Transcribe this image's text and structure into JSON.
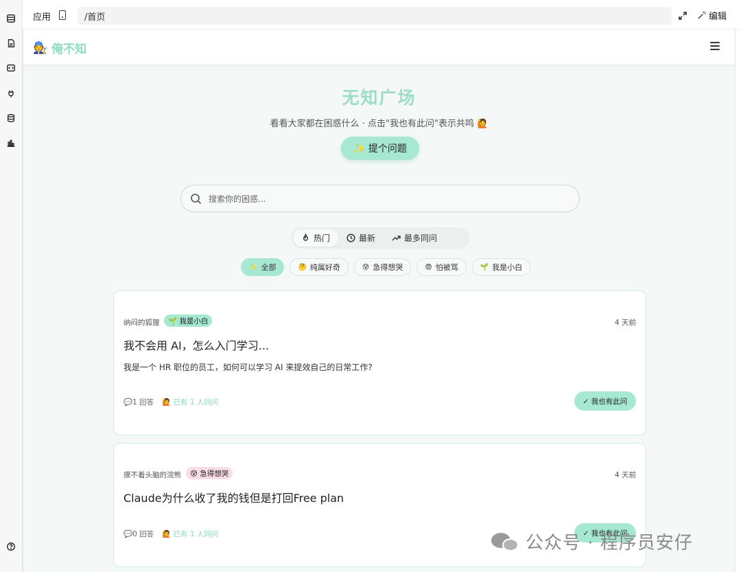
{
  "topbar": {
    "app_label": "应用",
    "path": "/首页",
    "edit_label": "编辑"
  },
  "header": {
    "logo_emoji": "🧑‍🔧",
    "brand": "俺不知"
  },
  "hero": {
    "title": "无知广场",
    "subtitle": "看看大家都在困惑什么 · 点击\"我也有此问\"表示共鸣 🙋",
    "ask_button": "✨ 提个问题"
  },
  "search": {
    "placeholder": "搜索你的困惑..."
  },
  "sort_tabs": [
    {
      "label": "热门",
      "icon": "flame-icon",
      "active": true
    },
    {
      "label": "最新",
      "icon": "clock-icon",
      "active": false
    },
    {
      "label": "最多同问",
      "icon": "trending-up-icon",
      "active": false
    }
  ],
  "filters": [
    {
      "emoji": "✨",
      "label": "全部",
      "active": true
    },
    {
      "emoji": "🤔",
      "label": "纯属好奇",
      "active": false
    },
    {
      "emoji": "😰",
      "label": "急得想哭",
      "active": false
    },
    {
      "emoji": "😨",
      "label": "怕被骂",
      "active": false
    },
    {
      "emoji": "🌱",
      "label": "我是小白",
      "active": false
    }
  ],
  "questions": [
    {
      "author": "纳闷的狐狸",
      "tag": "🌱 我是小白",
      "time": "4 天前",
      "title": "我不会用 AI，怎么入门学习...",
      "body": "我是一个 HR 职位的员工，如何可以学习 AI 来提效自己的日常工作?",
      "answers": "💬1 回答",
      "same": "🙋 已有 1 人同问",
      "button": "✓ 我也有此问"
    },
    {
      "author": "摸不着头脑的浣熊",
      "tag": "😰 急得想哭",
      "time": "4 天前",
      "title": "Claude为什么收了我的钱但是打回Free plan",
      "body": "",
      "answers": "💬0 回答",
      "same": "🙋 已有 1 人同问",
      "button": "✓ 我也有此问"
    }
  ],
  "watermark": "公众号 · 程序员安仔",
  "colors": {
    "accent": "#a7e8d3",
    "brand_text": "#8fdcc5",
    "background": "#f4f8f6",
    "pink_tag": "#f8dde6"
  }
}
